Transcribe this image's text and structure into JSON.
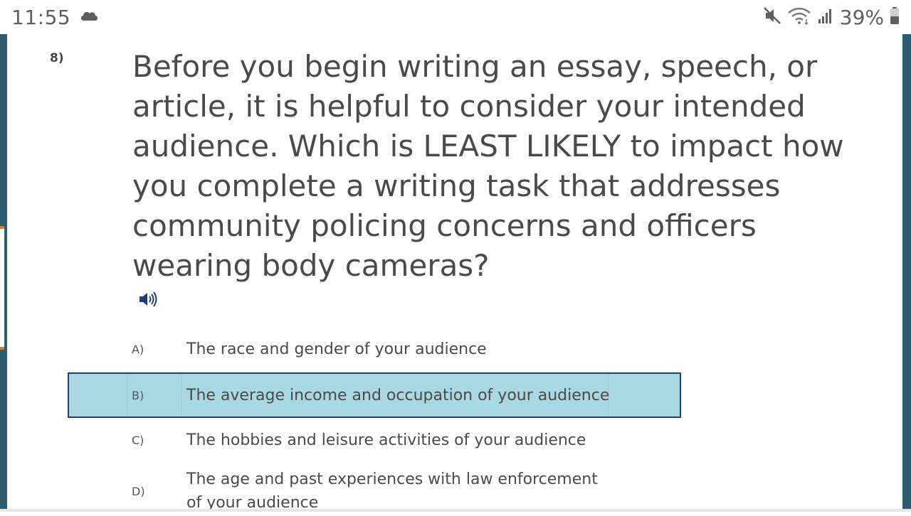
{
  "status_bar": {
    "time": "11:55",
    "left_icons": [
      "cloud-icon"
    ],
    "right_icons": [
      "mute-icon",
      "wifi-icon",
      "signal-icon",
      "battery-icon"
    ],
    "battery_percent": "39%"
  },
  "question": {
    "number": "8)",
    "text": "Before you begin writing an essay, speech, or article, it is helpful to consider your intended audience. Which is LEAST LIKELY to impact how you complete a writing task that addresses community policing concerns and officers wearing body cameras?",
    "audio_icon": "speaker-icon"
  },
  "options": [
    {
      "letter": "A)",
      "text": "The race and gender of your audience",
      "selected": false
    },
    {
      "letter": "B)",
      "text": "The average income and occupation of your audience",
      "selected": true
    },
    {
      "letter": "C)",
      "text": "The hobbies and leisure activities of your audience",
      "selected": false
    },
    {
      "letter": "D)",
      "text": "The age and past experiences with law enforcement of your audience",
      "selected": false
    }
  ],
  "colors": {
    "frame": "#2d5e6e",
    "accent": "#e07b2a",
    "selected_bg": "#a8d8e2",
    "selected_border": "#1f3f7a",
    "text": "#4a4a4a"
  }
}
